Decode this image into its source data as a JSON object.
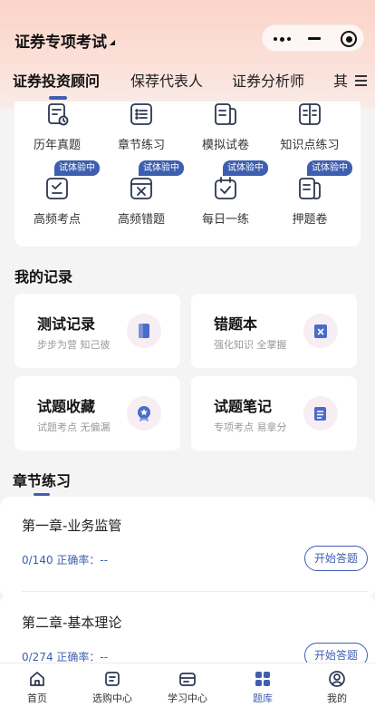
{
  "header": {
    "title": "证券专项考试",
    "capsule": {
      "more_icon": "more-dots-icon",
      "minimize_icon": "minimize-icon",
      "close_icon": "target-close-icon"
    }
  },
  "tabs": [
    {
      "label": "证券投资顾问",
      "active": true
    },
    {
      "label": "保荐代表人",
      "active": false
    },
    {
      "label": "证券分析师",
      "active": false
    },
    {
      "label": "其",
      "active": false
    }
  ],
  "quick_grid": [
    {
      "label": "历年真题",
      "icon": "exam-clock-icon"
    },
    {
      "label": "章节练习",
      "icon": "list-icon"
    },
    {
      "label": "模拟试卷",
      "icon": "papers-icon"
    },
    {
      "label": "知识点练习",
      "icon": "book-open-icon"
    },
    {
      "label": "高频考点",
      "icon": "checklist-icon",
      "badge": "试体验中"
    },
    {
      "label": "高频错题",
      "icon": "error-box-icon",
      "badge": "试体验中"
    },
    {
      "label": "每日一练",
      "icon": "calendar-check-icon",
      "badge": "试体验中"
    },
    {
      "label": "押题卷",
      "icon": "papers-icon",
      "badge": "试体验中"
    }
  ],
  "records": {
    "title": "我的记录",
    "items": [
      {
        "title": "测试记录",
        "subtitle": "步步为营 知己彼",
        "icon": "bookmark-doc-icon"
      },
      {
        "title": "错题本",
        "subtitle": "强化知识 全掌握",
        "icon": "wrong-book-icon"
      },
      {
        "title": "试题收藏",
        "subtitle": "试题考点 无偏漏",
        "icon": "medal-icon"
      },
      {
        "title": "试题笔记",
        "subtitle": "专项考点 易拿分",
        "icon": "notes-icon"
      }
    ]
  },
  "chapters": {
    "title": "章节练习",
    "items": [
      {
        "name": "第一章-业务监管",
        "progress": "0/140",
        "accuracy": "正确率：--",
        "button": "开始答题"
      },
      {
        "name": "第二章-基本理论",
        "progress": "0/274",
        "accuracy": "正确率：--",
        "button": "开始答题"
      }
    ]
  },
  "bottom_nav": [
    {
      "label": "首页",
      "icon": "home-icon",
      "active": false
    },
    {
      "label": "选购中心",
      "icon": "shop-icon",
      "active": false
    },
    {
      "label": "学习中心",
      "icon": "study-icon",
      "active": false
    },
    {
      "label": "题库",
      "icon": "grid-icon",
      "active": true
    },
    {
      "label": "我的",
      "icon": "user-icon",
      "active": false
    }
  ],
  "colors": {
    "accent": "#3e5fb0",
    "header_bg": "#fbd3c8",
    "icon_pink": "#f7eef4"
  }
}
